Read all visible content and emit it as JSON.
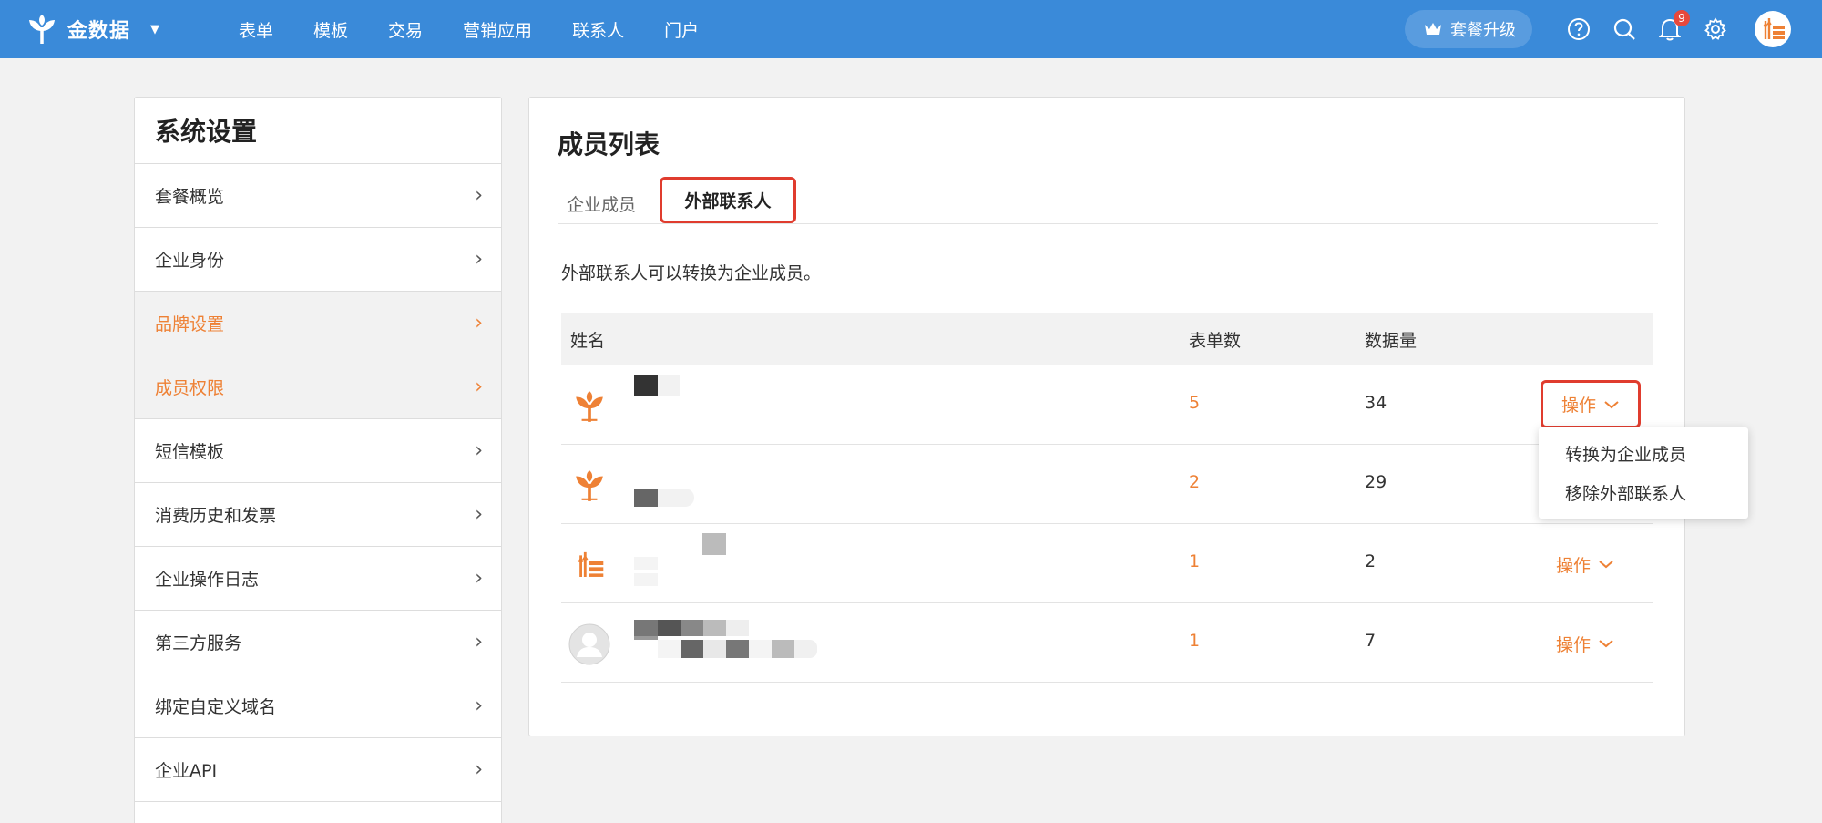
{
  "topbar": {
    "brand": "金数据",
    "nav": [
      "表单",
      "模板",
      "交易",
      "营销应用",
      "联系人",
      "门户"
    ],
    "upgrade_label": "套餐升级",
    "notification_count": "9",
    "accent_color": "#3a8ad9"
  },
  "sidebar": {
    "title": "系统设置",
    "items": [
      {
        "label": "套餐概览"
      },
      {
        "label": "企业身份"
      },
      {
        "label": "品牌设置"
      },
      {
        "label": "成员权限"
      },
      {
        "label": "短信模板"
      },
      {
        "label": "消费历史和发票"
      },
      {
        "label": "企业操作日志"
      },
      {
        "label": "第三方服务"
      },
      {
        "label": "绑定自定义域名"
      },
      {
        "label": "企业API"
      }
    ],
    "active_color": "#ee8135"
  },
  "main": {
    "title": "成员列表",
    "tabs": [
      {
        "label": "企业成员"
      },
      {
        "label": "外部联系人"
      }
    ],
    "description": "外部联系人可以转换为企业成员。",
    "table": {
      "columns": [
        "姓名",
        "表单数",
        "数据量"
      ],
      "rows": [
        {
          "forms": "5",
          "data": "34",
          "action": "操作"
        },
        {
          "forms": "2",
          "data": "29",
          "action": "操作"
        },
        {
          "forms": "1",
          "data": "2",
          "action": "操作"
        },
        {
          "forms": "1",
          "data": "7",
          "action": "操作"
        }
      ]
    },
    "dropdown": [
      "转换为企业成员",
      "移除外部联系人"
    ]
  }
}
